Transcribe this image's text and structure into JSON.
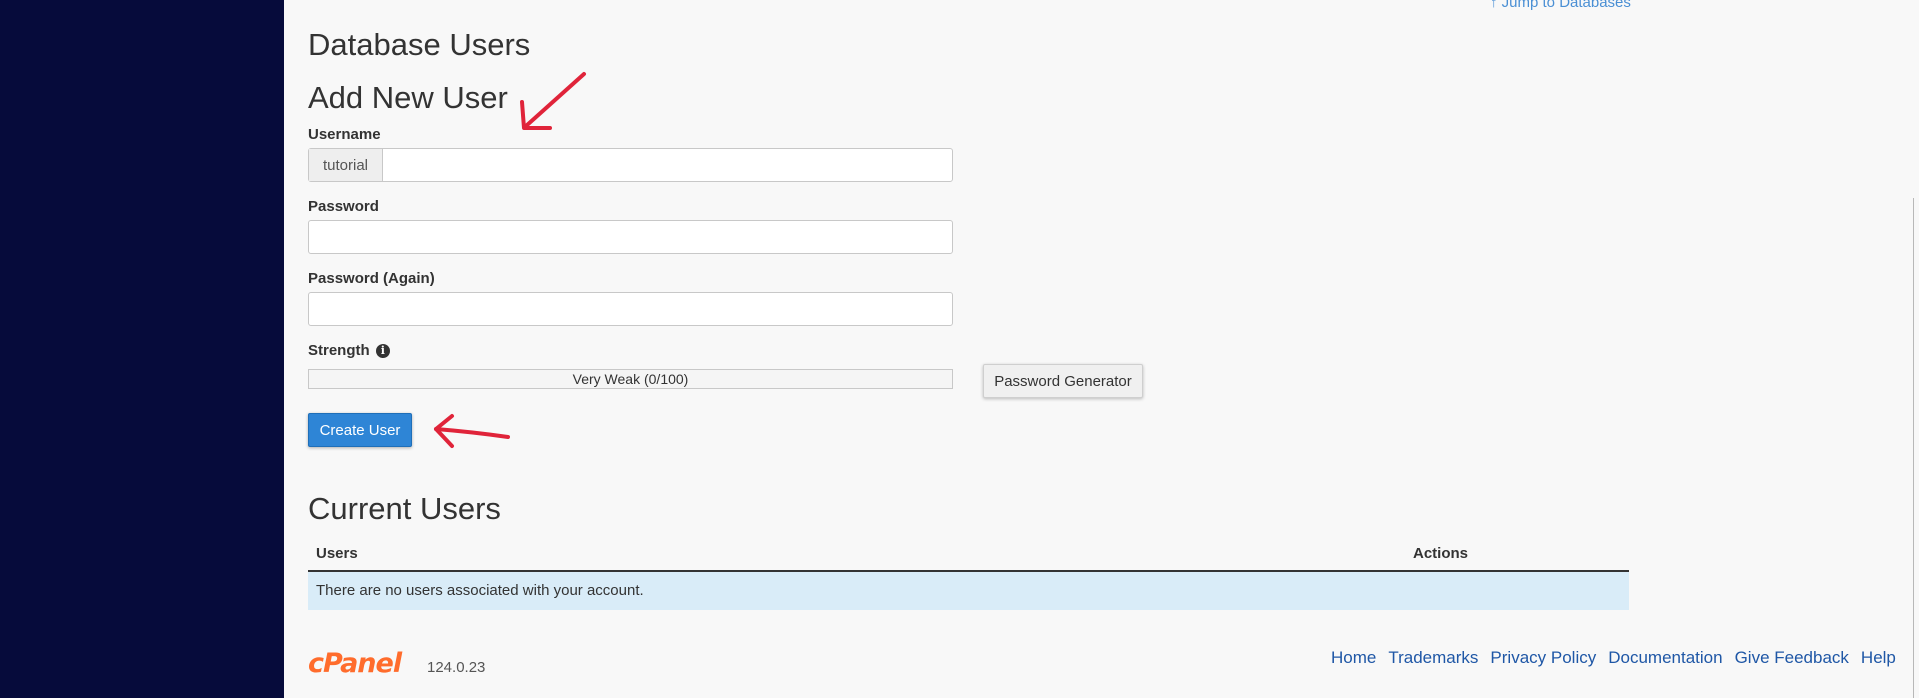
{
  "header": {
    "jump_link": "↑ Jump to Databases"
  },
  "page": {
    "title": "Database Users"
  },
  "add_user": {
    "title": "Add New User",
    "username_label": "Username",
    "username_prefix": "tutorial",
    "username_value": "",
    "password_label": "Password",
    "password_value": "",
    "password_again_label": "Password (Again)",
    "password_again_value": "",
    "strength_label": "Strength",
    "strength_text": "Very Weak (0/100)",
    "strength_value": 0,
    "password_generator_label": "Password Generator",
    "create_button_label": "Create User"
  },
  "current_users": {
    "title": "Current Users",
    "columns": [
      "Users",
      "Actions"
    ],
    "empty_message": "There are no users associated with your account."
  },
  "footer": {
    "logo_text": "cPanel",
    "version": "124.0.23",
    "links": [
      "Home",
      "Trademarks",
      "Privacy Policy",
      "Documentation",
      "Give Feedback",
      "Help"
    ]
  },
  "icons": {
    "info": "info-circle-icon",
    "annotation_arrows": "red-arrow-icon"
  },
  "colors": {
    "sidebar": "#060b3b",
    "primary_button": "#2e85d6",
    "link": "#1f57a6",
    "brand": "#ff6c2c",
    "annotation": "#e0243a",
    "empty_row": "#d9ecf8"
  }
}
